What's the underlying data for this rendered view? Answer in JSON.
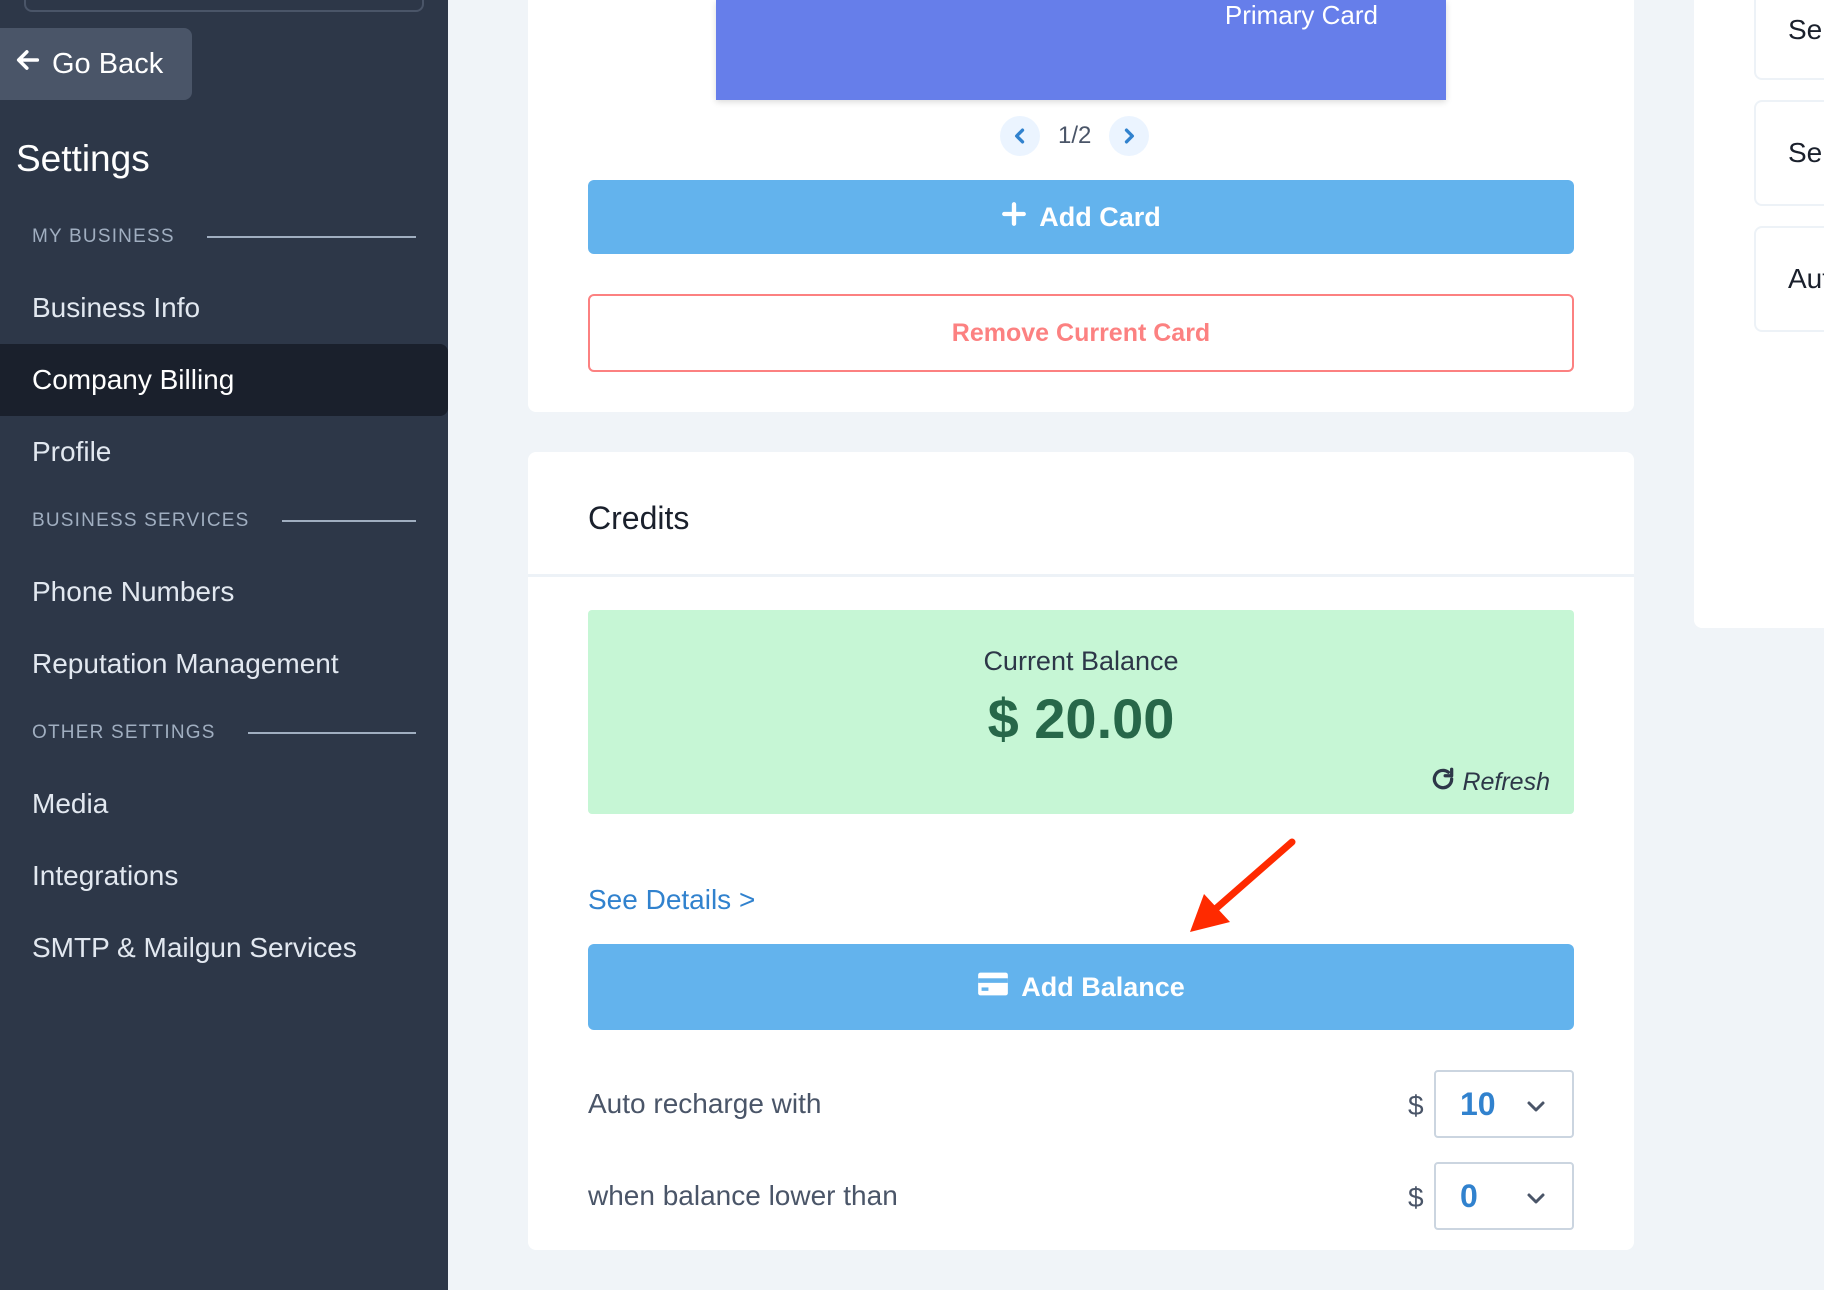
{
  "sidebar": {
    "go_back": "Go Back",
    "title": "Settings",
    "sections": {
      "my_business": "MY BUSINESS",
      "business_services": "BUSINESS SERVICES",
      "other_settings": "OTHER SETTINGS"
    },
    "items": {
      "business_info": "Business Info",
      "company_billing": "Company Billing",
      "profile": "Profile",
      "phone_numbers": "Phone Numbers",
      "reputation_management": "Reputation Management",
      "media": "Media",
      "integrations": "Integrations",
      "smtp": "SMTP & Mailgun Services"
    },
    "active_item": "Company Billing"
  },
  "cards": {
    "primary_label": "Primary Card",
    "pager": "1/2",
    "add_card": "Add Card",
    "remove_card": "Remove Current Card",
    "card_color": "#667eea"
  },
  "credits": {
    "title": "Credits",
    "balance_label": "Current Balance",
    "balance_value": "$ 20.00",
    "refresh": "Refresh",
    "see_details": "See Details >",
    "add_balance": "Add Balance",
    "auto_recharge_label": "Auto recharge with",
    "auto_recharge_currency": "$",
    "auto_recharge_value": "10",
    "threshold_label": "when balance lower than",
    "threshold_currency": "$",
    "threshold_value": "0"
  },
  "right_tiles": [
    "Sep",
    "Sep",
    "Aut"
  ],
  "icons": {
    "go_back": "arrow-left-icon",
    "prev": "chevron-left-icon",
    "next": "chevron-right-icon",
    "add_card": "plus-icon",
    "refresh": "refresh-icon",
    "add_balance": "credit-card-icon",
    "dropdown": "chevron-down-icon"
  },
  "colors": {
    "sidebar_bg": "#2d3748",
    "active_bg": "#1a202c",
    "primary_button": "#63b3ed",
    "danger": "#fc8181",
    "balance_bg": "#c6f6d5",
    "balance_text": "#276749",
    "link": "#3182ce",
    "annotation_arrow": "#ff2a00"
  }
}
